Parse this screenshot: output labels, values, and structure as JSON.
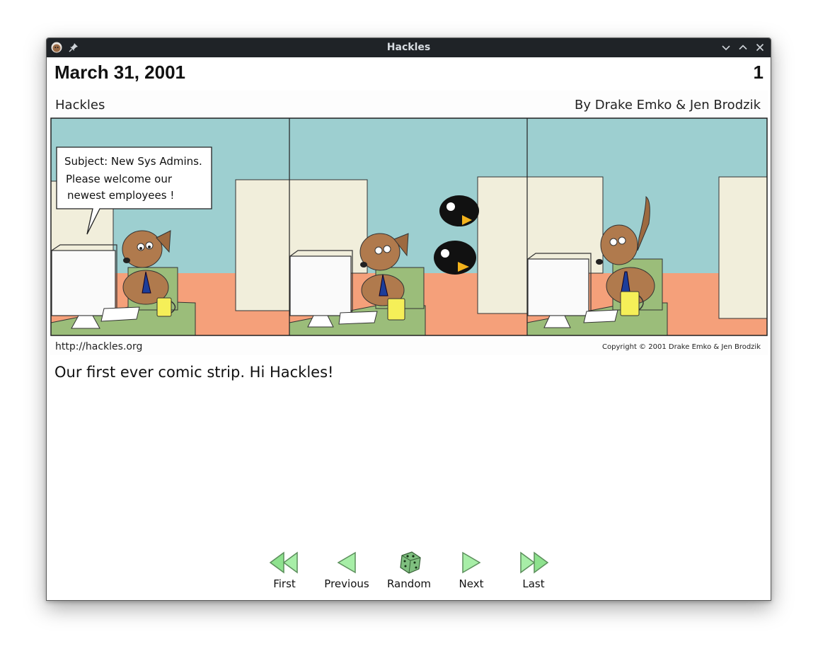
{
  "window": {
    "title": "Hackles"
  },
  "header": {
    "date": "March 31, 2001",
    "number": "1"
  },
  "comic": {
    "title": "Hackles",
    "authors": "By Drake Emko & Jen Brodzik",
    "url": "http://hackles.org",
    "copyright": "Copyright © 2001 Drake Emko & Jen Brodzik",
    "speech_bubble": [
      "Subject: New Sys Admins.",
      "Please welcome our",
      "newest employees !"
    ]
  },
  "caption": "Our first ever comic strip. Hi Hackles!",
  "nav": {
    "first": "First",
    "previous": "Previous",
    "random": "Random",
    "next": "Next",
    "last": "Last"
  }
}
